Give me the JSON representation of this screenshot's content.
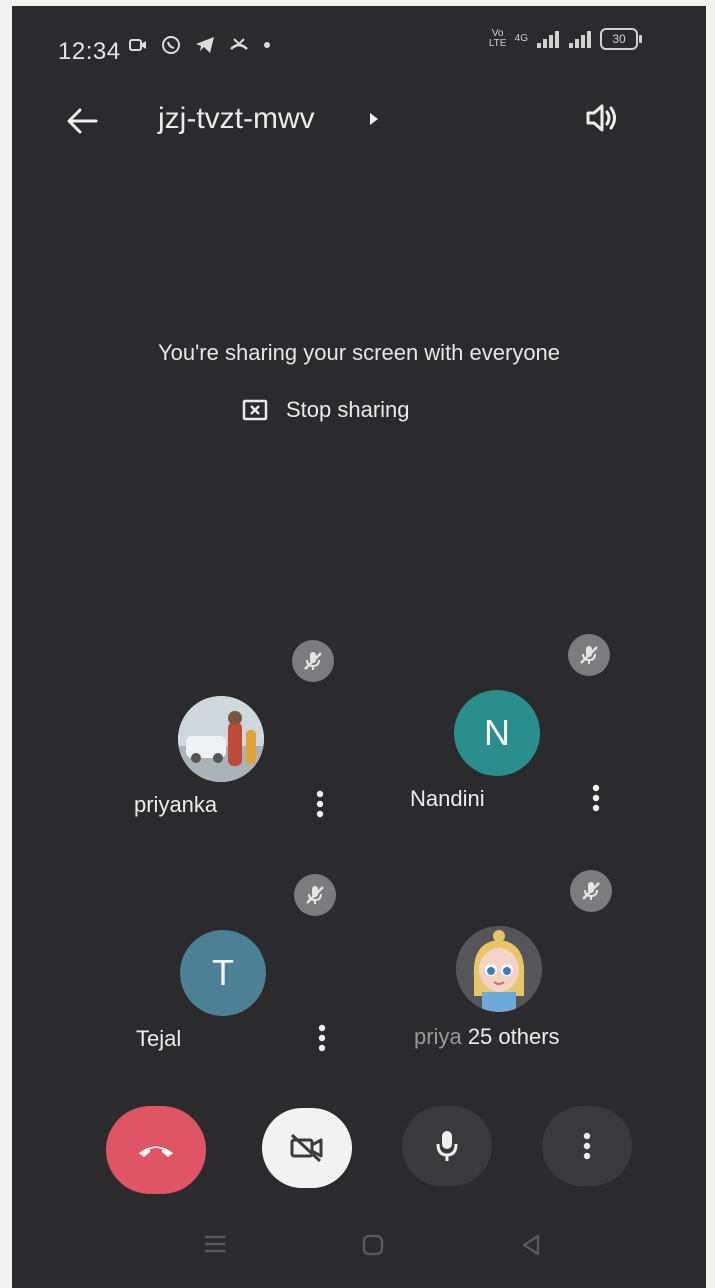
{
  "status_bar": {
    "time": "12:34",
    "network_label": "Vo LTE",
    "signal_label": "4G",
    "battery": "30"
  },
  "app_bar": {
    "meeting_code": "jzj-tvzt-mwv"
  },
  "sharing": {
    "message": "You're sharing your screen with everyone",
    "stop_label": "Stop sharing"
  },
  "participants": [
    {
      "name": "priyanka",
      "avatar_type": "photo",
      "muted": true
    },
    {
      "name": "Nandini",
      "avatar_letter": "N",
      "avatar_color": "#2a8f8c",
      "muted": true
    },
    {
      "name": "Tejal",
      "avatar_letter": "T",
      "avatar_color": "#4d7f95",
      "muted": true
    },
    {
      "name_partial": "priya",
      "others_label": "25 others",
      "avatar_type": "cartoon",
      "muted": true
    }
  ],
  "controls": {
    "end_call_color": "#e05566",
    "camera_state": "off",
    "mic_state": "on"
  },
  "icons": {
    "back": "arrow-left-icon",
    "speaker": "speaker-icon",
    "mute": "mic-off-icon",
    "more": "more-vertical-icon",
    "end_call": "phone-hangup-icon",
    "camera_off": "video-off-icon",
    "mic": "mic-icon"
  }
}
